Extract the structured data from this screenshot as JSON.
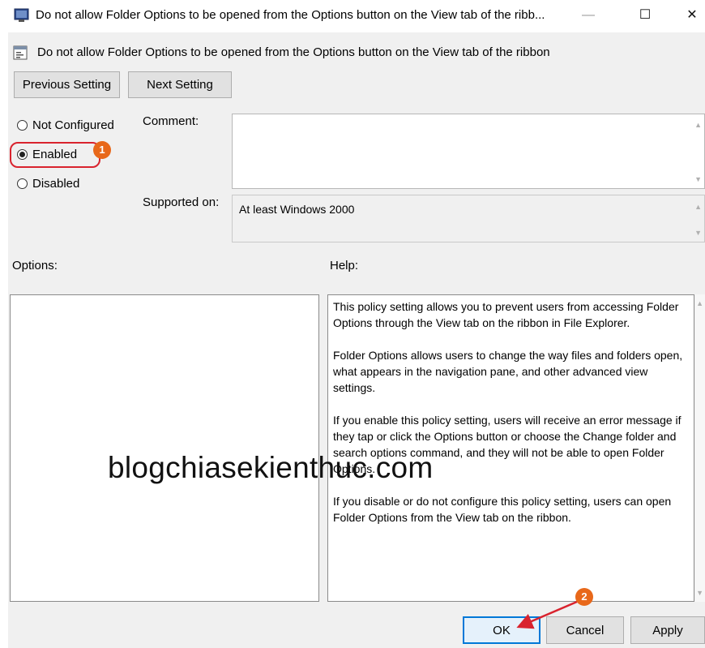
{
  "window": {
    "title": "Do not allow Folder Options to be opened from the Options button on the View tab of the ribb...",
    "minimize_glyph": "—",
    "maximize_glyph": "☐",
    "close_glyph": "✕"
  },
  "policy": {
    "title": "Do not allow Folder Options to be opened from the Options button on the View tab of the ribbon"
  },
  "nav": {
    "previous_label": "Previous Setting",
    "next_label": "Next Setting"
  },
  "state": {
    "options": [
      {
        "label": "Not Configured",
        "checked": false
      },
      {
        "label": "Enabled",
        "checked": true
      },
      {
        "label": "Disabled",
        "checked": false
      }
    ]
  },
  "comment": {
    "label": "Comment:",
    "value": ""
  },
  "supported": {
    "label": "Supported on:",
    "value": "At least Windows 2000"
  },
  "options_label": "Options:",
  "help": {
    "label": "Help:",
    "paragraphs": [
      "This policy setting allows you to prevent users from accessing Folder Options through the View tab on the ribbon in File Explorer.",
      "Folder Options allows users to change the way files and folders open, what appears in the navigation pane, and other advanced view settings.",
      "If you enable this policy setting, users will receive an error message if they tap or click the Options button or choose the Change folder and search options command, and they will not be able to open Folder Options.",
      "If you disable or do not configure this policy setting, users can open Folder Options from the View tab on the ribbon."
    ]
  },
  "footer": {
    "ok_label": "OK",
    "cancel_label": "Cancel",
    "apply_label": "Apply"
  },
  "annotations": {
    "step1": "1",
    "step2": "2",
    "marker_color": "#e8681a",
    "highlight_color": "#d9232e"
  },
  "watermark": "blogchiasekienthuc.com",
  "icons": [
    "policy-window-icon",
    "policy-setting-icon",
    "minimize-icon",
    "maximize-icon",
    "close-icon",
    "scroll-up-icon",
    "scroll-down-icon"
  ]
}
